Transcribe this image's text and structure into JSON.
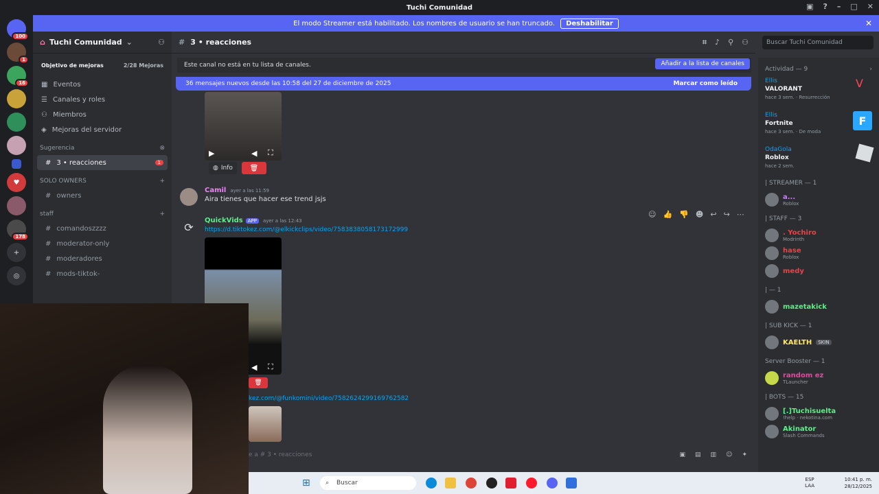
{
  "titlebar": {
    "title": "Tuchi Comunidad"
  },
  "banner": {
    "text": "El modo Streamer está habilitado. Los nombres de usuario se han truncado.",
    "button": "Deshabilitar"
  },
  "guilds": {
    "badges": [
      "100",
      "1",
      "16",
      "178"
    ]
  },
  "sidebar": {
    "server_name": "Tuchi Comunidad",
    "boost_label": "Objetivo de mejoras",
    "boost_count": "2/28 Mejoras",
    "nav": [
      "Eventos",
      "Canales y roles",
      "Miembros",
      "Mejoras del servidor"
    ],
    "suggestion_label": "Sugerencia",
    "suggested_channel": "3 • reacciones",
    "suggested_unread": "1",
    "categories": [
      {
        "name": "SOLO OWNERS",
        "channels": [
          "owners"
        ]
      },
      {
        "name": "staff",
        "channels": [
          "comandoszzzz",
          "moderator-only",
          "moderadores",
          "mods-tiktok-"
        ]
      }
    ]
  },
  "channel": {
    "name": "3 • reacciones"
  },
  "search": {
    "placeholder": "Buscar Tuchi Comunidad"
  },
  "notice": {
    "text": "Este canal no está en tu lista de canales.",
    "button": "Añadir a la lista de canales"
  },
  "newmsg": {
    "text": "36 mensajes nuevos desde las 10:58 del 27 de diciembre de 2025",
    "mark": "Marcar como leído"
  },
  "messages": {
    "info_label": "Info",
    "m1": {
      "author": "Camil",
      "time": "ayer a las 11:59",
      "text": "Aira tienes que hacer ese trend jsjs"
    },
    "m2": {
      "author": "QuickVids",
      "tag": "APP",
      "time": "ayer a las 12:43",
      "link": "https://d.tiktokez.com/@elkickclips/video/7583838058173172999"
    },
    "m3": {
      "link": "kez.com/@funkomini/video/7582624299169762582"
    }
  },
  "composer": {
    "placeholder": "e a #   3 • reacciones"
  },
  "members": {
    "activity_label": "Actividad — 9",
    "activities": [
      {
        "name": "Ellis",
        "game": "VALORANT",
        "sub": "hace 3 sem.",
        "extra": "Resurrección"
      },
      {
        "name": "Ellis",
        "game": "Fortnite",
        "sub": "hace 3 sem.",
        "extra": "De moda"
      },
      {
        "name": "OdaGola",
        "game": "Roblox",
        "sub": "hace 2 sem.",
        "extra": ""
      }
    ],
    "groups": [
      {
        "label": "| STREAMER — 1",
        "members": [
          {
            "name": "a...",
            "sub": "Roblox",
            "color": "#c77dff"
          }
        ]
      },
      {
        "label": "| STAFF — 3",
        "members": [
          {
            "name": ". Yochiro",
            "sub": "Modrinth",
            "color": "#f23f43"
          },
          {
            "name": "hase",
            "sub": "Roblox",
            "color": "#f23f43"
          },
          {
            "name": "medy",
            "sub": "",
            "color": "#f23f43"
          }
        ]
      },
      {
        "label": "| — 1",
        "members": [
          {
            "name": "mazetakick",
            "sub": "",
            "color": "#57f287"
          }
        ]
      },
      {
        "label": "| SUB KICK — 1",
        "members": [
          {
            "name": "KAELTH",
            "sub": "SKIN",
            "color": "#fee75c"
          }
        ]
      },
      {
        "label": "Server Booster — 1",
        "members": [
          {
            "name": "random ez",
            "sub": "TLauncher",
            "color": "#eb459e"
          }
        ]
      },
      {
        "label": "| BOTS — 15",
        "members": [
          {
            "name": "[.]Tuchisuelta",
            "sub": "!help · nekotina.com",
            "color": "#57f287"
          },
          {
            "name": "Akinator",
            "sub": "Slash Commands",
            "color": "#57f287"
          }
        ]
      }
    ]
  },
  "taskbar": {
    "search": "Buscar",
    "lang": "ESP",
    "lang2": "LAA",
    "time": "10:41 p. m.",
    "date": "28/12/2025"
  }
}
